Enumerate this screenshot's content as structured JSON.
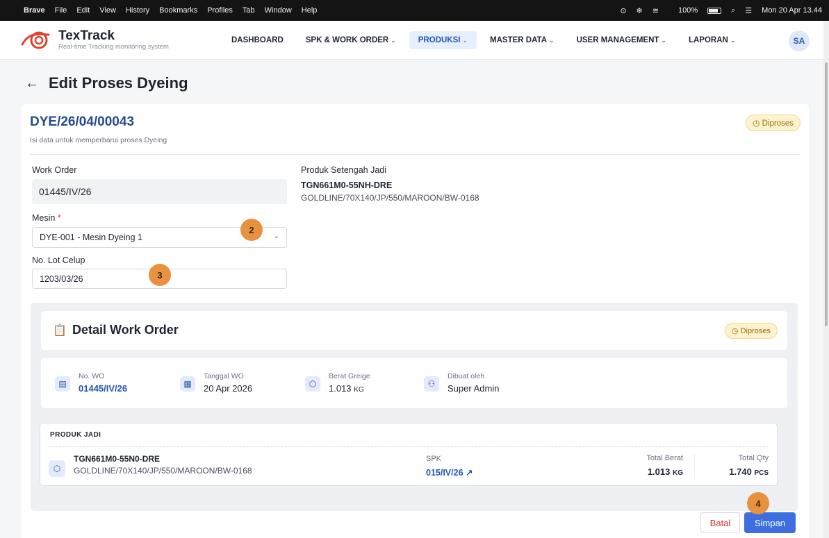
{
  "menubar": {
    "app": "Brave",
    "items": [
      "File",
      "Edit",
      "View",
      "History",
      "Bookmarks",
      "Profiles",
      "Tab",
      "Window",
      "Help"
    ],
    "battery": "100%",
    "clock": "Mon 20 Apr 13.44"
  },
  "brand": {
    "name": "TexTrack",
    "tagline": "Real-time Tracking monitoring system"
  },
  "nav": {
    "items": [
      {
        "label": "DASHBOARD",
        "dropdown": false
      },
      {
        "label": "SPK & WORK ORDER",
        "dropdown": true
      },
      {
        "label": "PRODUKSI",
        "dropdown": true,
        "active": true
      },
      {
        "label": "MASTER DATA",
        "dropdown": true
      },
      {
        "label": "USER MANAGEMENT",
        "dropdown": true
      },
      {
        "label": "LAPORAN",
        "dropdown": true
      }
    ],
    "avatar": "SA"
  },
  "page": {
    "title": "Edit Proses Dyeing"
  },
  "record": {
    "code": "DYE/26/04/00043",
    "subtitle": "Isi data untuk memperbarui proses Dyeing",
    "status": "Diproses"
  },
  "form": {
    "work_order_label": "Work Order",
    "work_order_value": "01445/IV/26",
    "mesin_label": "Mesin",
    "required_mark": "*",
    "mesin_value": "DYE-001 - Mesin Dyeing 1",
    "lot_label": "No. Lot Celup",
    "lot_value": "1203/03/26",
    "produk_label": "Produk Setengah Jadi",
    "produk_code": "TGN661M0-55NH-DRE",
    "produk_desc": "GOLDLINE/70X140/JP/550/MAROON/BW-0168"
  },
  "markers": [
    "2",
    "3",
    "4"
  ],
  "work_order_detail": {
    "title": "Detail Work Order",
    "status": "Diproses",
    "stats": [
      {
        "label": "No. WO",
        "value": "01445/IV/26",
        "icon": "document-icon"
      },
      {
        "label": "Tanggal WO",
        "value": "20 Apr 2026",
        "icon": "calendar-icon"
      },
      {
        "label": "Berat Greige",
        "value": "1.013",
        "unit": "KG",
        "icon": "box-icon"
      },
      {
        "label": "Dibuat oleh",
        "value": "Super Admin",
        "icon": "user-icon"
      }
    ],
    "produk_jadi": {
      "header": "PRODUK JADI",
      "code": "TGN661M0-55N0-DRE",
      "desc": "GOLDLINE/70X140/JP/550/MAROON/BW-0168",
      "spk_label": "SPK",
      "spk_value": "015/IV/26 ↗",
      "total_berat_label": "Total Berat",
      "total_berat_value": "1.013",
      "total_berat_unit": "KG",
      "total_qty_label": "Total Qty",
      "total_qty_value": "1.740",
      "total_qty_unit": "PCS"
    }
  },
  "actions": {
    "cancel": "Batal",
    "save": "Simpan"
  }
}
